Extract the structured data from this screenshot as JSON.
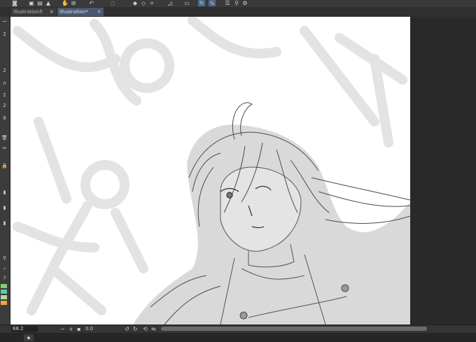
{
  "toolbar": {
    "icons": [
      "camera-icon",
      "folder-icon",
      "save-icon",
      "hand-icon",
      "transform-icon",
      "fill-icon",
      "undo-icon",
      "selection-icon",
      "crop-icon",
      "pen-tool-icon",
      "layer-icon",
      "settings-icon"
    ]
  },
  "tabs": [
    {
      "label": "Illustration5",
      "active": false
    },
    {
      "label": "Illustration*",
      "active": true
    }
  ],
  "left_panel": {
    "labels": [
      "ー",
      "2",
      "2",
      "n",
      "2",
      "2",
      "8"
    ]
  },
  "status": {
    "zoom": "68.2",
    "angle": "0.0",
    "minus": "−",
    "plus": "+"
  },
  "colors": {
    "ui_dark": "#2b2b2b",
    "active_tab": "#4a5770",
    "swatch_green": "#7fd06a",
    "swatch_teal": "#5fc7a6",
    "swatch_orange": "#f3a43a"
  }
}
